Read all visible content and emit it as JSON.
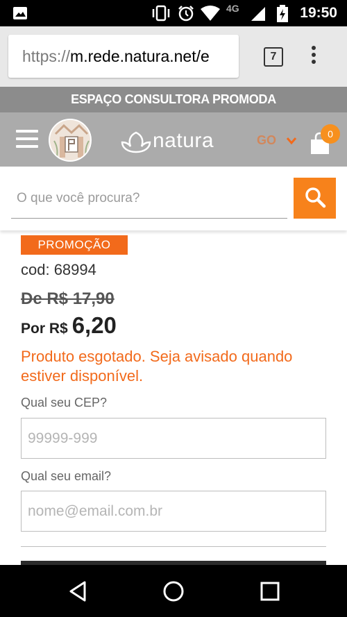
{
  "status_bar": {
    "time": "19:50",
    "network": "4G",
    "icons": [
      "image-icon",
      "vibrate-icon",
      "alarm-icon",
      "wifi-icon",
      "signal-icon",
      "battery-charging-icon"
    ]
  },
  "browser": {
    "url_scheme": "https://",
    "url_host": "m.rede.natura.net/e",
    "tab_count": "7"
  },
  "promo_bar": {
    "text": "ESPAÇO  CONSULTORA PROMODA"
  },
  "header": {
    "logo_text": "natura",
    "state": "GO",
    "cart_count": "0",
    "colors": {
      "header_bg": "#ababab",
      "accent": "#f26a1b",
      "badge": "#f7901e"
    }
  },
  "search": {
    "placeholder": "O que você procura?"
  },
  "product": {
    "tag": "PROMOÇÃO",
    "code": "cod: 68994",
    "old_price": "De R$ 17,90",
    "price_prefix": "Por R$",
    "price_value": "6,20",
    "out_of_stock": "Produto esgotado. Seja avisado quando estiver disponível."
  },
  "notify_form": {
    "cep_label": "Qual seu CEP?",
    "cep_placeholder": "99999-999",
    "email_label": "Qual seu email?",
    "email_placeholder": "nome@email.com.br"
  },
  "nav": {
    "buttons": [
      "back-icon",
      "home-icon",
      "recents-icon"
    ]
  }
}
